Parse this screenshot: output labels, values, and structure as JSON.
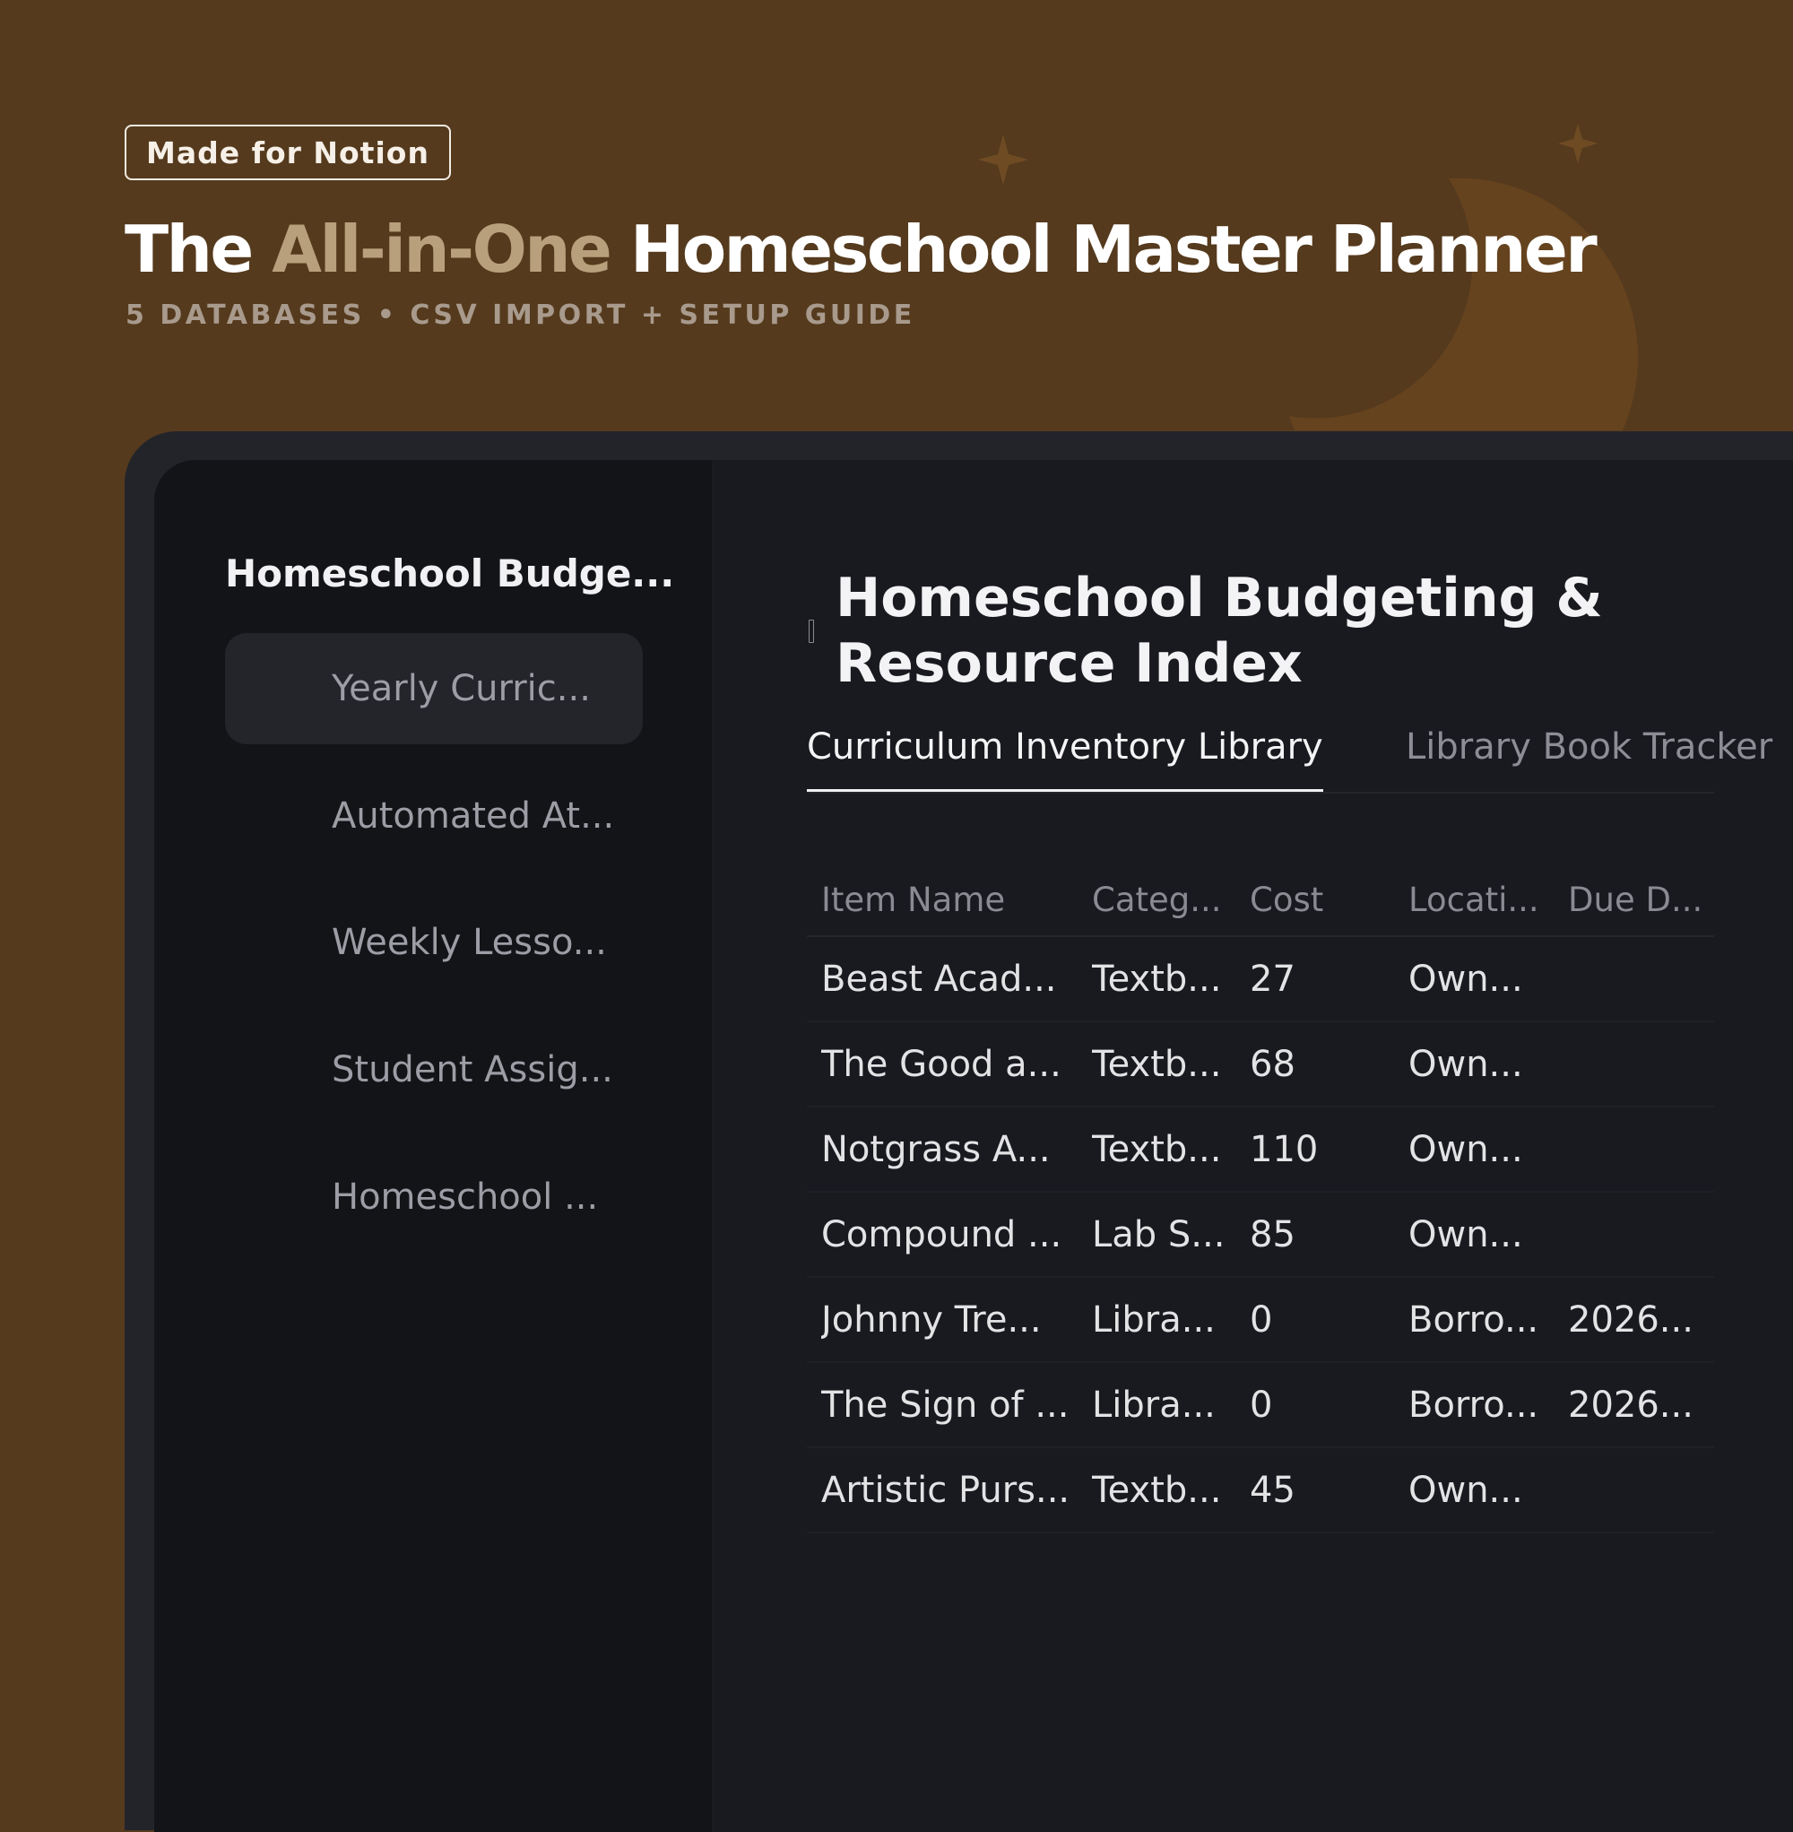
{
  "hero": {
    "badge": "Made for Notion",
    "title_pre": "The ",
    "title_accent": "All-in-One",
    "title_post": " Homeschool Master Planner",
    "subtitle": "5 DATABASES • CSV IMPORT + SETUP GUIDE"
  },
  "colors": {
    "background": "#553a1d",
    "accent": "#b9a07c",
    "moon": "#6a4520",
    "panel": "#131418",
    "main": "#191a1f"
  },
  "sidebar": {
    "title": "Homeschool Budge...",
    "items": [
      {
        "label": "Yearly Curric...",
        "active": true
      },
      {
        "label": "Automated At..."
      },
      {
        "label": "Weekly Lesso..."
      },
      {
        "label": "Student Assig..."
      },
      {
        "label": "Homeschool ..."
      }
    ]
  },
  "page": {
    "title_line1": "Homeschool Budgeting &",
    "title_line2": "Resource Index",
    "tabs": [
      {
        "label": "Curriculum Inventory Library",
        "active": true
      },
      {
        "label": "Library Book Tracker"
      }
    ]
  },
  "table": {
    "columns": [
      "Item Name",
      "Categ...",
      "Cost",
      "Locati...",
      "Due D..."
    ],
    "rows": [
      [
        "Beast Acad...",
        "Textb...",
        "27",
        "Own...",
        ""
      ],
      [
        "The Good a...",
        "Textb...",
        "68",
        "Own...",
        ""
      ],
      [
        "Notgrass A...",
        "Textb...",
        "110",
        "Own...",
        ""
      ],
      [
        "Compound ...",
        "Lab S...",
        "85",
        "Own...",
        ""
      ],
      [
        "Johnny Tre...",
        "Libra...",
        "0",
        "Borro...",
        "2026..."
      ],
      [
        "The Sign of ...",
        "Libra...",
        "0",
        "Borro...",
        "2026..."
      ],
      [
        "Artistic Purs...",
        "Textb...",
        "45",
        "Own...",
        ""
      ]
    ]
  }
}
